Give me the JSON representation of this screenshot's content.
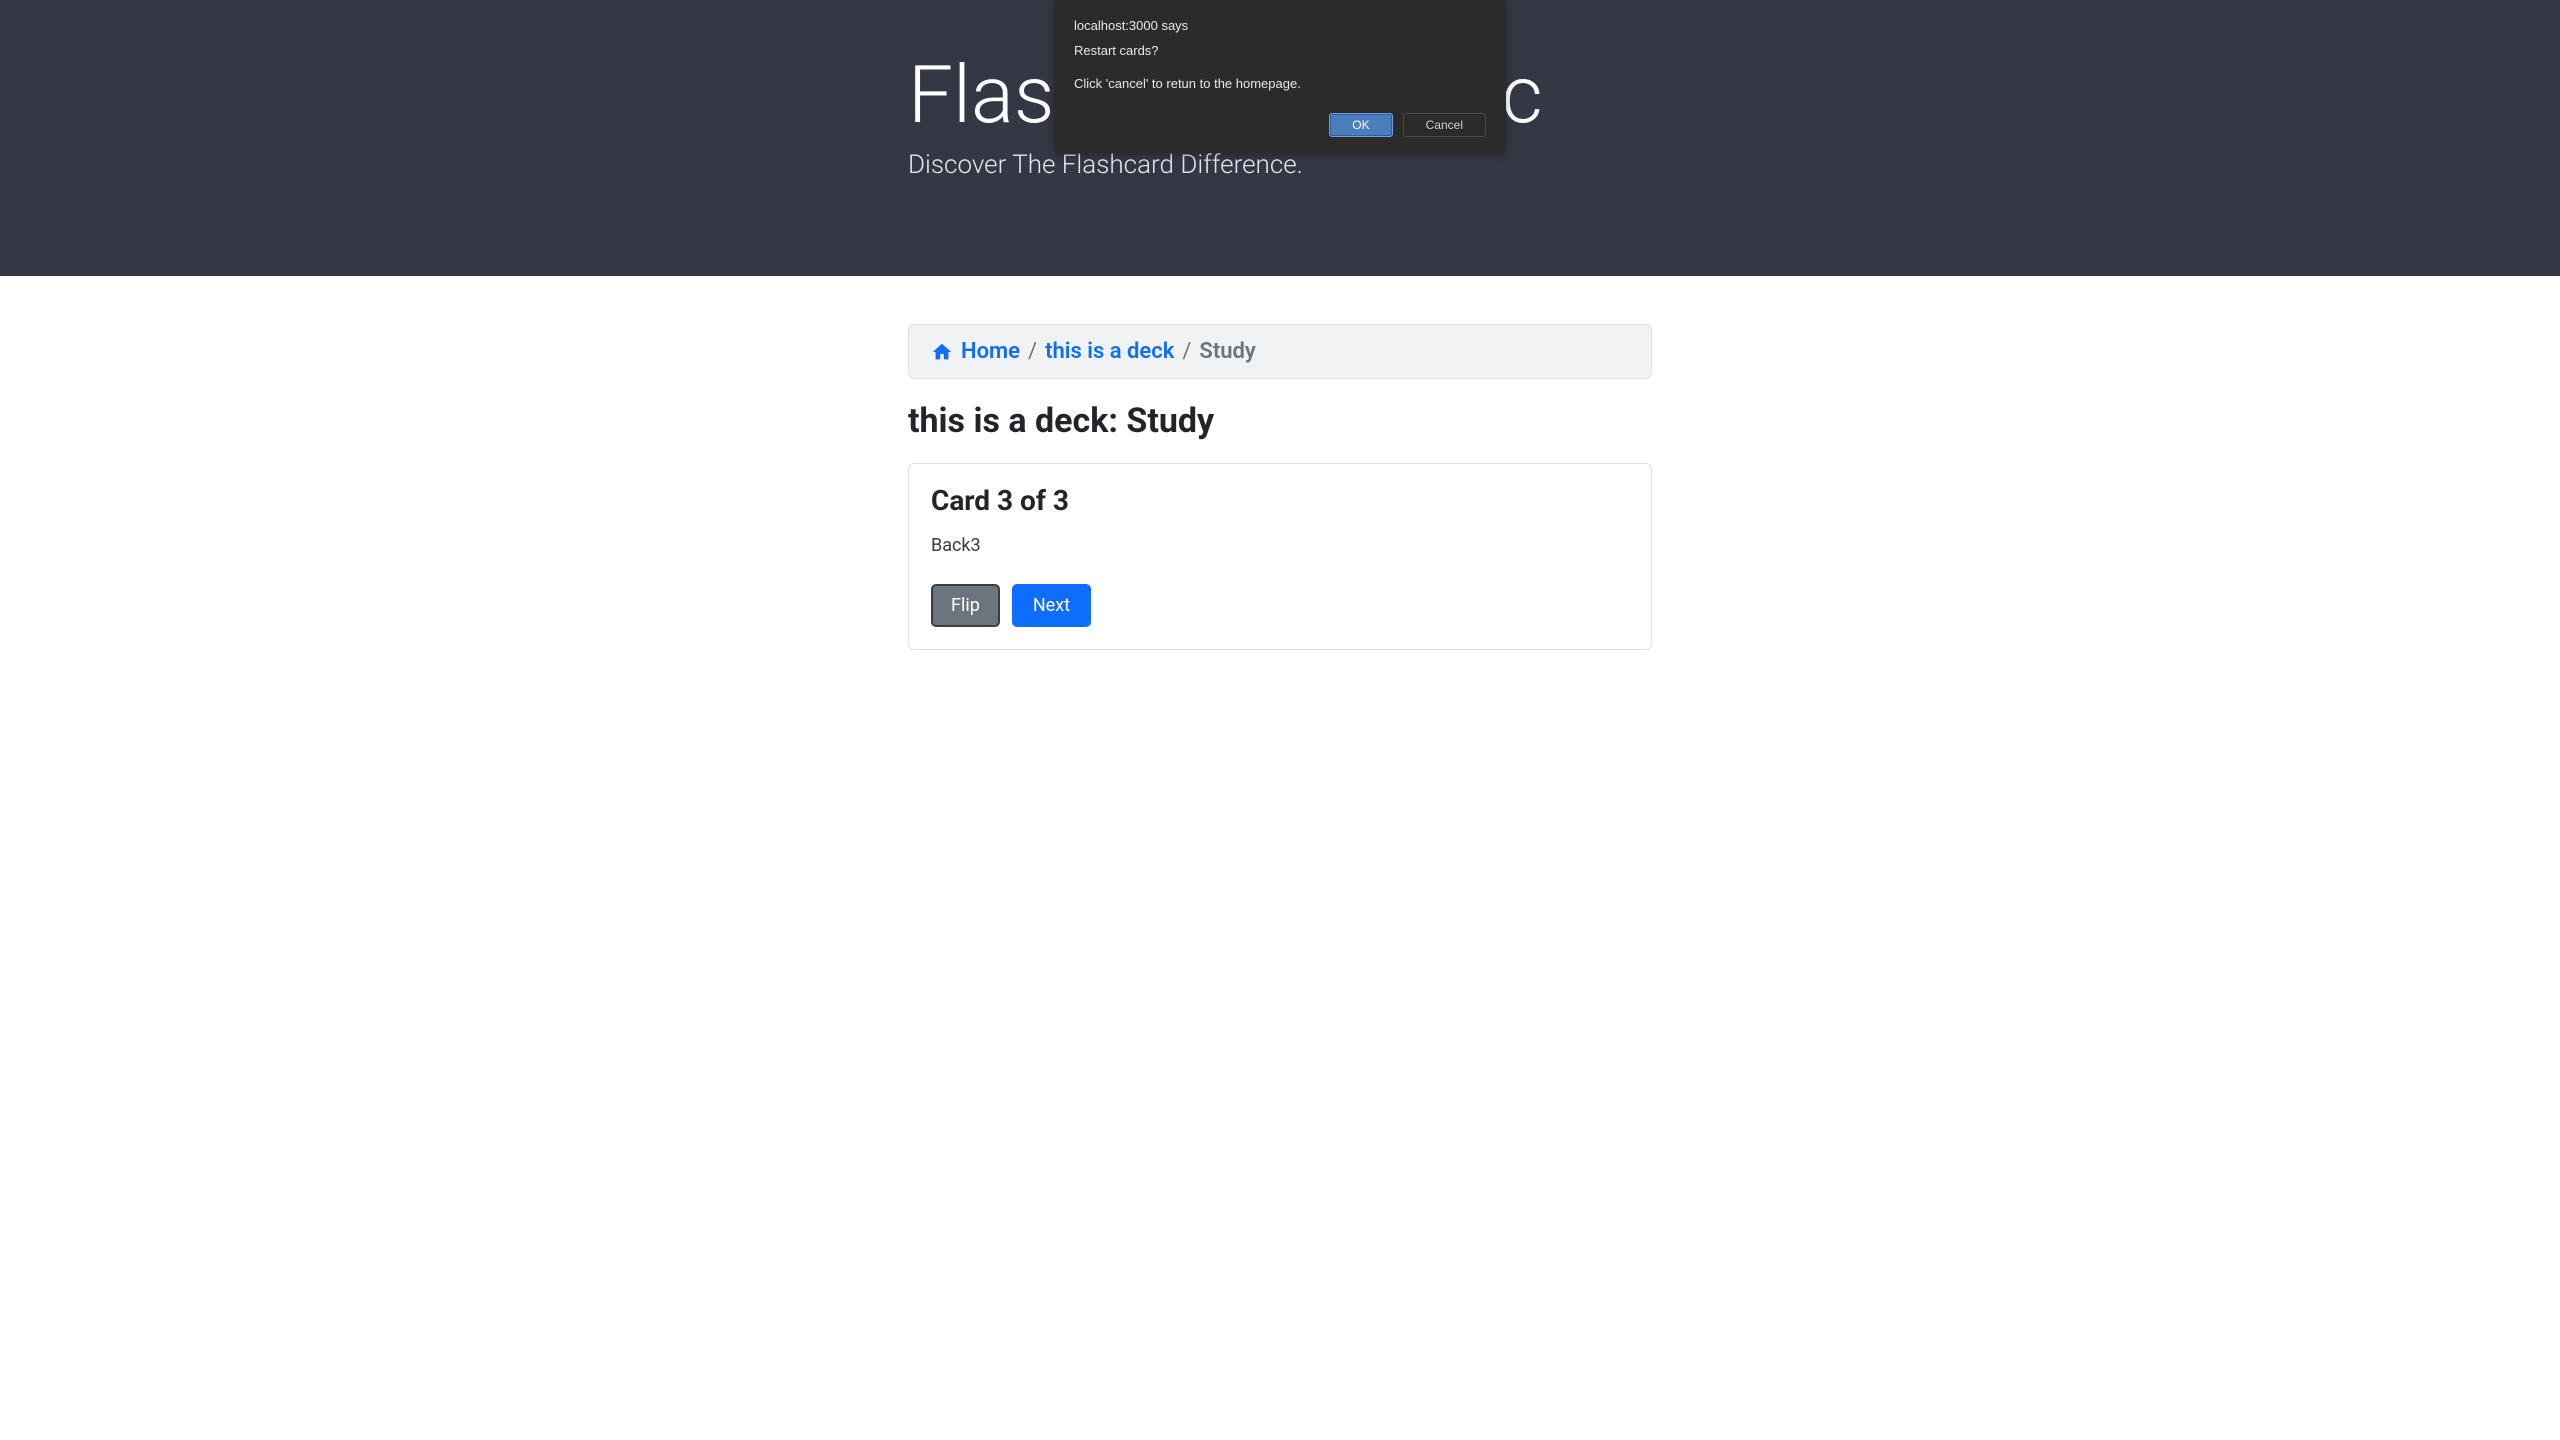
{
  "header": {
    "title": "Flashcard-o-matic",
    "subtitle": "Discover The Flashcard Difference."
  },
  "breadcrumb": {
    "home_label": "Home",
    "deck_label": "this is a deck",
    "current": "Study"
  },
  "page": {
    "title": "this is a deck: Study"
  },
  "card": {
    "counter": "Card 3 of 3",
    "content": "Back3",
    "flip_label": "Flip",
    "next_label": "Next"
  },
  "alert": {
    "origin": "localhost:3000 says",
    "line1": "Restart cards?",
    "line2": "Click 'cancel' to retun to the homepage.",
    "ok_label": "OK",
    "cancel_label": "Cancel"
  }
}
